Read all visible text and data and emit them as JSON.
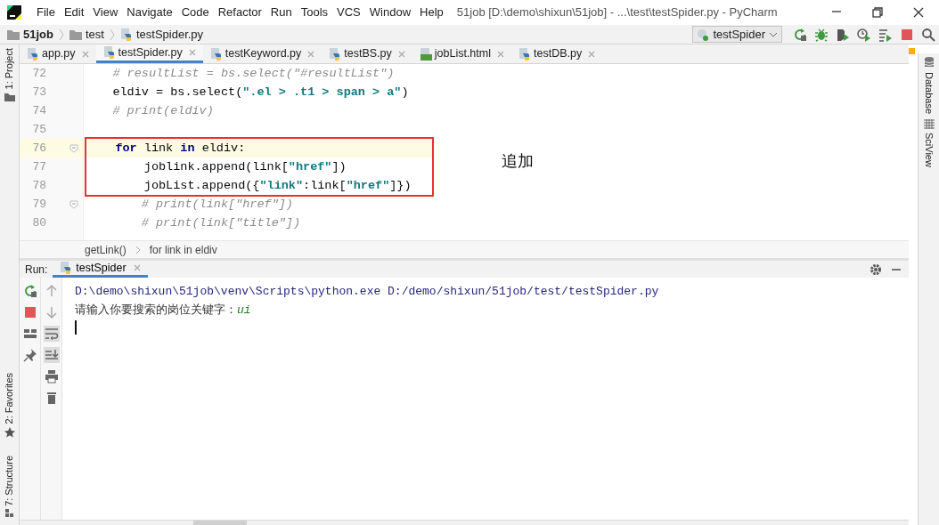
{
  "window": {
    "title": "51job [D:\\demo\\shixun\\51job] - ...\\test\\testSpider.py - PyCharm"
  },
  "menu": [
    "File",
    "Edit",
    "View",
    "Navigate",
    "Code",
    "Refactor",
    "Run",
    "Tools",
    "VCS",
    "Window",
    "Help"
  ],
  "breadcrumbs": [
    {
      "label": "51job",
      "kind": "folder"
    },
    {
      "label": "test",
      "kind": "folder"
    },
    {
      "label": "testSpider.py",
      "kind": "python"
    }
  ],
  "run_config": "testSpider",
  "toolbar": [
    {
      "kind": "rerun"
    },
    {
      "kind": "debug"
    },
    {
      "kind": "coverage"
    },
    {
      "kind": "profile"
    },
    {
      "kind": "concurrency"
    },
    {
      "kind": "stop"
    },
    {
      "kind": "search"
    }
  ],
  "left_tool_windows": [
    {
      "label": "1: Project",
      "kind": "project"
    },
    {
      "label": "2: Favorites",
      "kind": "favorites"
    },
    {
      "label": "7: Structure",
      "kind": "structure"
    }
  ],
  "right_tool_windows": [
    {
      "label": "Database",
      "kind": "database"
    },
    {
      "label": "SciView",
      "kind": "sciview"
    }
  ],
  "tabs": [
    {
      "label": "app.py",
      "kind": "python",
      "selected": false
    },
    {
      "label": "testSpider.py",
      "kind": "python",
      "selected": true
    },
    {
      "label": "testKeyword.py",
      "kind": "python",
      "selected": false
    },
    {
      "label": "testBS.py",
      "kind": "python",
      "selected": false
    },
    {
      "label": "jobList.html",
      "kind": "html",
      "selected": false
    },
    {
      "label": "testDB.py",
      "kind": "python",
      "selected": false
    }
  ],
  "code_lines": [
    {
      "number": "72",
      "current": false,
      "fold": false,
      "boxed": false,
      "tokens": [
        {
          "kind": "comment",
          "text": "    # resultList = bs.select(\"#resultList\")"
        }
      ]
    },
    {
      "number": "73",
      "current": false,
      "fold": false,
      "boxed": false,
      "tokens": [
        {
          "kind": "plain",
          "text": "    eldiv = bs.select("
        },
        {
          "kind": "string",
          "text": "\".el > .t1 > span > a\""
        },
        {
          "kind": "plain",
          "text": ")"
        }
      ]
    },
    {
      "number": "74",
      "current": false,
      "fold": false,
      "boxed": false,
      "tokens": [
        {
          "kind": "comment",
          "text": "    # print(eldiv)"
        }
      ]
    },
    {
      "number": "75",
      "current": false,
      "fold": false,
      "boxed": false
    },
    {
      "number": "76",
      "current": true,
      "fold": true,
      "boxed": true,
      "tokens": [
        {
          "kind": "keyword",
          "text": "    for"
        },
        {
          "kind": "plain",
          "text": " link "
        },
        {
          "kind": "keyword",
          "text": "in"
        },
        {
          "kind": "plain",
          "text": " eldiv:"
        }
      ]
    },
    {
      "number": "77",
      "current": false,
      "fold": false,
      "boxed": true,
      "tokens": [
        {
          "kind": "plain",
          "text": "        joblink.append(link["
        },
        {
          "kind": "string",
          "text": "\"href\""
        },
        {
          "kind": "plain",
          "text": "])"
        }
      ]
    },
    {
      "number": "78",
      "current": false,
      "fold": false,
      "boxed": true,
      "tokens": [
        {
          "kind": "plain",
          "text": "        jobList.append({"
        },
        {
          "kind": "string",
          "text": "\"link\""
        },
        {
          "kind": "plain",
          "text": ":link["
        },
        {
          "kind": "string",
          "text": "\"href\""
        },
        {
          "kind": "plain",
          "text": "]})"
        }
      ]
    },
    {
      "number": "79",
      "current": false,
      "fold": true,
      "boxed": false,
      "tokens": [
        {
          "kind": "comment",
          "text": "        # print(link[\"href\"])"
        }
      ]
    },
    {
      "number": "80",
      "current": false,
      "fold": false,
      "boxed": false,
      "tokens": [
        {
          "kind": "comment",
          "text": "        # print(link[\"title\"])"
        }
      ]
    }
  ],
  "annotation": {
    "text": "追加"
  },
  "editor_breadcrumbs": [
    "getLink()",
    "for link in eldiv"
  ],
  "run_panel": {
    "label": "Run:",
    "tab": {
      "label": "testSpider",
      "selected": true
    },
    "toolbar_left": [
      {
        "kind": "rerun"
      },
      {
        "kind": "stop"
      },
      {
        "kind": "layout"
      },
      {
        "kind": "pin"
      }
    ],
    "toolbar_right": [
      {
        "kind": "up",
        "selected": false
      },
      {
        "kind": "down",
        "selected": false
      },
      {
        "kind": "wrap",
        "selected": true
      },
      {
        "kind": "scroll-end",
        "selected": true
      },
      {
        "kind": "print",
        "selected": false
      },
      {
        "kind": "trash",
        "selected": false
      }
    ],
    "output": [
      {
        "kind": "command",
        "text": "D:\\demo\\shixun\\51job\\venv\\Scripts\\python.exe D:/demo/shixun/51job/test/testSpider.py"
      },
      {
        "kind": "prompt",
        "text": "请输入你要搜索的岗位关键字：",
        "input": "ui"
      },
      {
        "kind": "caret"
      }
    ]
  }
}
